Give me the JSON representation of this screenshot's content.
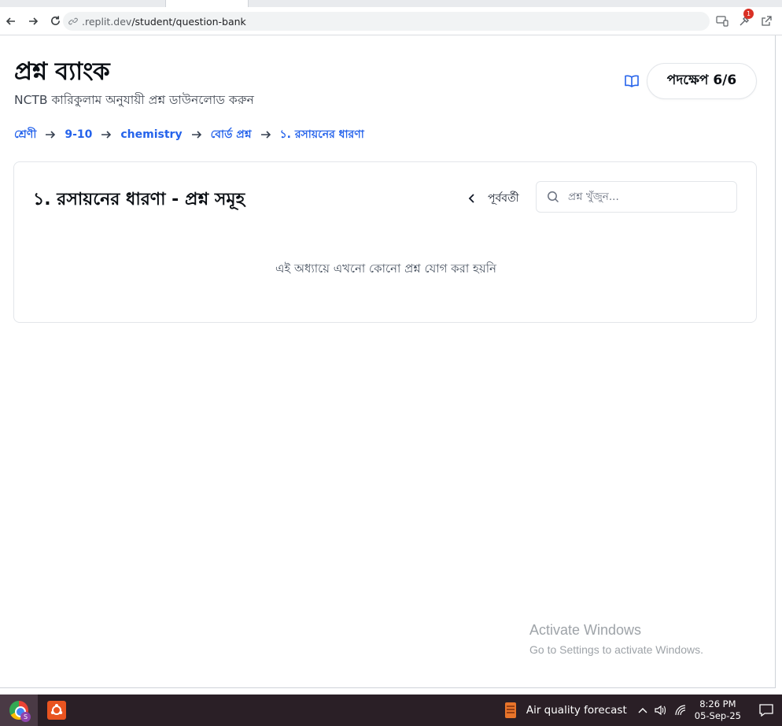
{
  "browser": {
    "url_host": ".replit.dev",
    "url_path": "/student/question-bank",
    "extension_badge": "1"
  },
  "header": {
    "title": "প্রশ্ন ব্যাংক",
    "subtitle": "NCTB কারিকুলাম অনুযায়ী প্রশ্ন ডাউনলোড করুন",
    "step_label": "পদক্ষেপ 6/6"
  },
  "breadcrumb": {
    "items": [
      "শ্রেণী",
      "9-10",
      "chemistry",
      "বোর্ড প্রশ্ন",
      "১. রসায়নের ধারণা"
    ]
  },
  "card": {
    "title": "১. রসায়নের ধারণা - প্রশ্ন সমূহ",
    "prev_label": "পূর্ববর্তী",
    "search_placeholder": "প্রশ্ন খুঁজুন...",
    "empty_message": "এই অধ্যায়ে এখনো কোনো প্রশ্ন যোগ করা হয়নি"
  },
  "watermark": {
    "title": "Activate Windows",
    "subtitle": "Go to Settings to activate Windows."
  },
  "taskbar": {
    "chrome_badge": "S",
    "weather_label": "Air quality forecast",
    "time": "8:26 PM",
    "date": "05-Sep-25"
  },
  "colors": {
    "accent": "#2563eb",
    "taskbar": "#2a1f26"
  },
  "icons": [
    "back-arrow-icon",
    "forward-arrow-icon",
    "reload-icon",
    "link-icon",
    "cast-icon",
    "extensions-icon",
    "open-external-icon",
    "book-icon",
    "arrow-right-icon",
    "chevron-left-icon",
    "search-icon",
    "chrome-icon",
    "ubuntu-icon",
    "air-quality-icon",
    "chevron-up-icon",
    "volume-icon",
    "wifi-icon",
    "notification-icon"
  ]
}
